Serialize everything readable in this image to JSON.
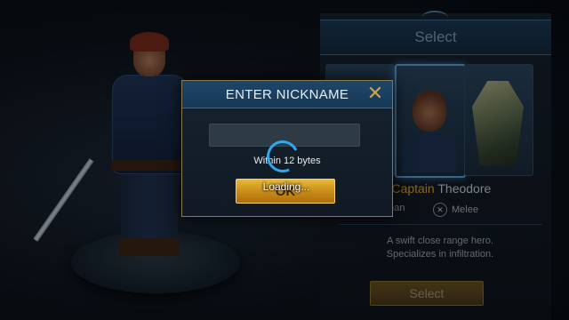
{
  "select_panel": {
    "header": "Select",
    "hero_title_prefix": "Patrol Captain",
    "hero_name": "Theodore",
    "race": "Human",
    "class": "Melee",
    "description_line1": "A swift close range hero.",
    "description_line2": "Specializes in infiltration.",
    "select_button": "Select"
  },
  "dialog": {
    "title": "ENTER NICKNAME",
    "close_symbol": "✕",
    "nickname_value": "",
    "hint": "Within 12 bytes",
    "ok_button": "OK"
  },
  "loading": {
    "text": "Loading..."
  },
  "colors": {
    "accent_gold": "#d9a72e",
    "accent_blue": "#2ea8f0"
  }
}
